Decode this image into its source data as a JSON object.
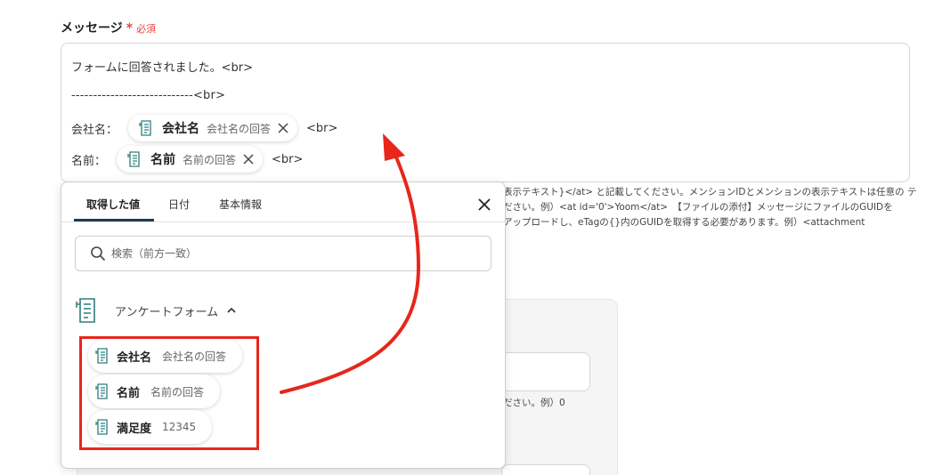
{
  "field": {
    "label": "メッセージ",
    "required_star": "*",
    "required_text": "必須"
  },
  "message": {
    "line1": "フォームに回答されました。<br>",
    "line2": "----------------------------<br>",
    "line3_prefix": "会社名：",
    "line3_chip": {
      "name": "会社名",
      "desc": "会社名の回答"
    },
    "line3_suffix": "<br>",
    "line4_prefix": "名前：",
    "line4_chip": {
      "name": "名前",
      "desc": "名前の回答"
    },
    "line4_suffix": "<br>"
  },
  "help_lines": [
    "表示テキスト}</at> と記載してください。メンションIDとメンションの表示テキストは任意の テ",
    "ださい。例）<at id='0'>Yoom</at>　【ファイルの添付】メッセージにファイルのGUIDを",
    "アップロードし、eTagの{}内のGUIDを取得する必要があります。例）<attachment"
  ],
  "background_note": "ださい。例）0",
  "popup": {
    "tabs": [
      {
        "label": "取得した値",
        "active": true
      },
      {
        "label": "日付",
        "active": false
      },
      {
        "label": "基本情報",
        "active": false
      }
    ],
    "search_placeholder": "検索（前方一致）",
    "group_label": "アンケートフォーム",
    "options": [
      {
        "name": "会社名",
        "desc": "会社名の回答"
      },
      {
        "name": "名前",
        "desc": "名前の回答"
      },
      {
        "name": "満足度",
        "desc": "12345"
      }
    ]
  },
  "colors": {
    "accent_red": "#e8261b",
    "required_red": "#e8453c",
    "tab_underline": "#1f3b57"
  },
  "icons": [
    "form-doc-icon",
    "close-icon",
    "search-icon",
    "chevron-up-icon"
  ]
}
